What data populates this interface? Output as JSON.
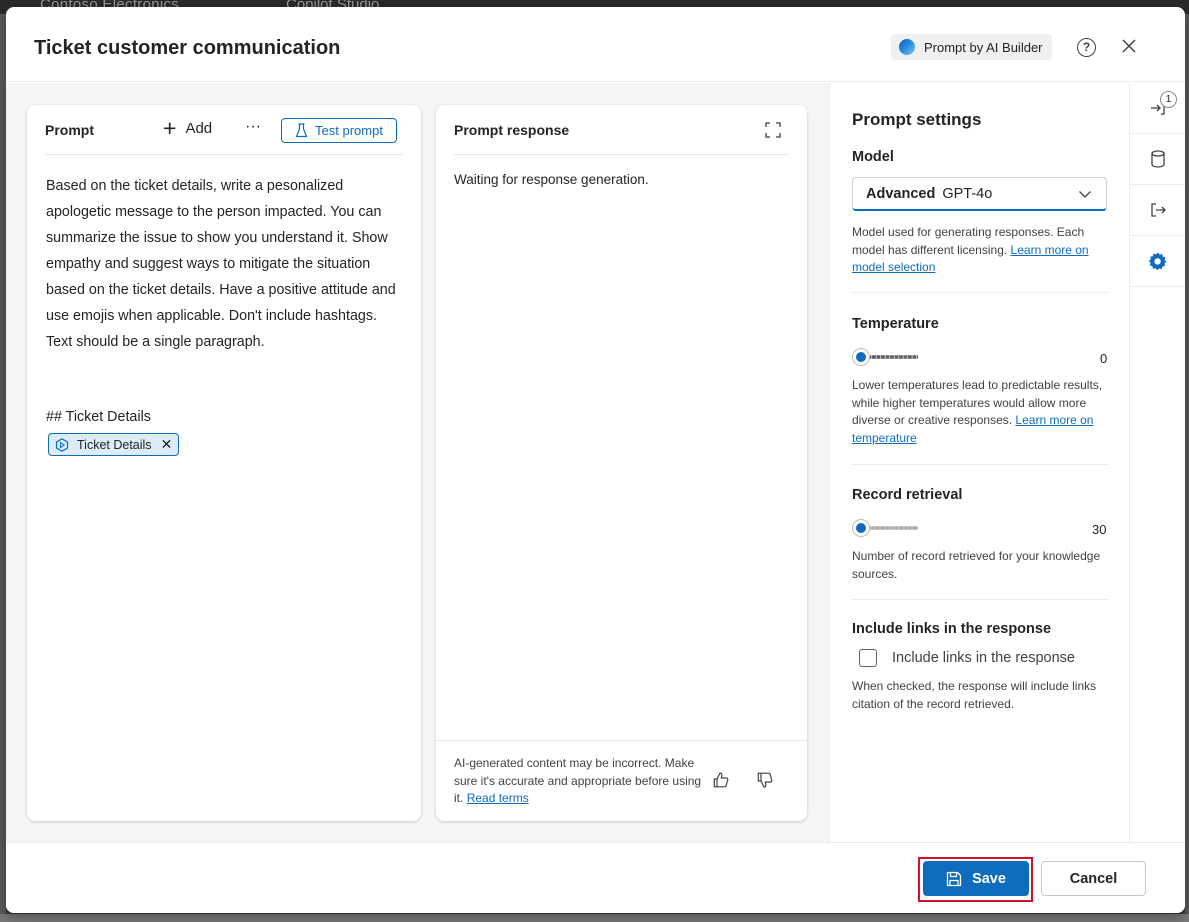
{
  "background_app": {
    "title": "Contoso Electronics",
    "product": "Copilot Studio"
  },
  "dialog": {
    "title": "Ticket customer communication",
    "badge_label": "Prompt by AI Builder",
    "help_glyph": "?",
    "help_icon": "question-circle-icon",
    "close_icon": "close-icon"
  },
  "prompt_panel": {
    "header": "Prompt",
    "add_label": "Add",
    "more_glyph": "···",
    "test_label": "Test prompt",
    "text": "Based on the ticket details, write a pesonalized apologetic message to the person impacted. You can summarize the issue to show you understand it. Show empathy and suggest ways to mitigate the situation based on the ticket details. Have a positive attitude and use emojis when applicable. Don't include hashtags. Text should be a single paragraph.",
    "section_heading": "## Ticket Details",
    "input_token": "Ticket Details"
  },
  "response_panel": {
    "header": "Prompt response",
    "waiting_text": "Waiting for response generation.",
    "disclaimer_text": "AI-generated content may be incorrect. Make sure it's accurate and appropriate before using it.",
    "read_terms_label": "Read terms"
  },
  "settings": {
    "title": "Prompt settings",
    "model": {
      "label": "Model",
      "tier": "Advanced",
      "name": "GPT-4o",
      "help": "Model used for generating responses. Each model has different licensing.",
      "link": "Learn more on model selection"
    },
    "temperature": {
      "label": "Temperature",
      "value": "0",
      "level": 0,
      "help": "Lower temperatures lead to predictable results, while higher temperatures would allow more diverse or creative responses.",
      "link": "Learn more on temperature"
    },
    "record_retrieval": {
      "label": "Record retrieval",
      "value": "30",
      "level": 0,
      "help": "Number of record retrieved for your knowledge sources."
    },
    "include_links": {
      "label": "Include links in the response",
      "checkbox_label": "Include links in the response",
      "checked": false,
      "help": "When checked, the response will include links citation of the record retrieved."
    }
  },
  "rail": {
    "badge_count": "1",
    "icons": [
      "sign-in-icon",
      "database-icon",
      "sign-out-icon",
      "gear-icon"
    ]
  },
  "footer": {
    "save_label": "Save",
    "cancel_label": "Cancel"
  },
  "colors": {
    "accent": "#0f6cbd",
    "highlight_outline": "#d0112b"
  }
}
